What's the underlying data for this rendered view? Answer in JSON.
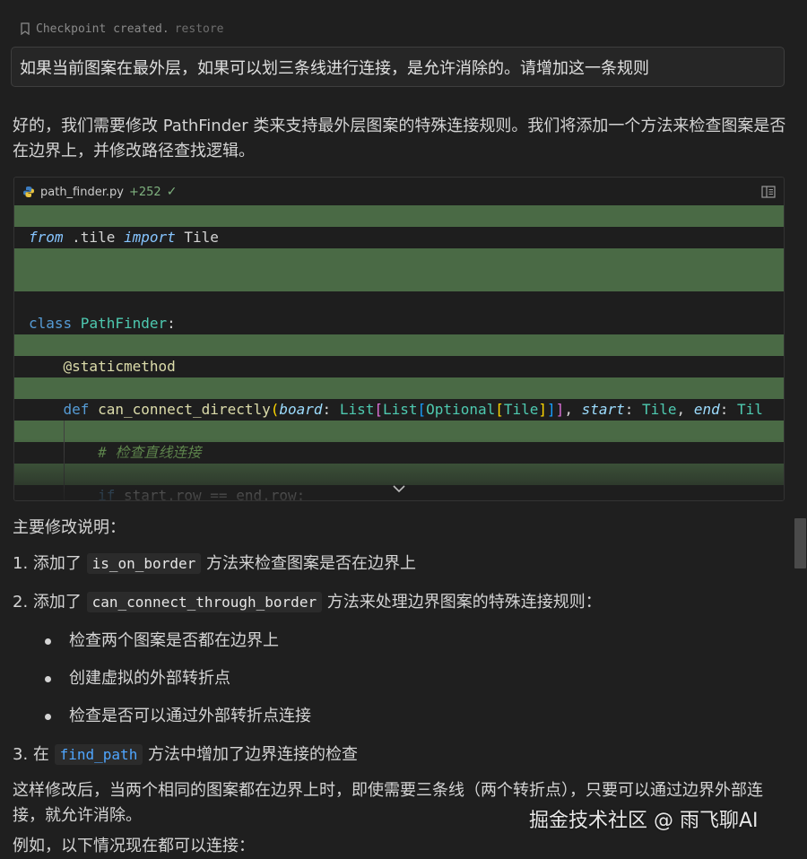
{
  "checkpoint": {
    "text": "Checkpoint created.",
    "restore": "restore"
  },
  "user_message": "如果当前图案在最外层，如果可以划三条线进行连接，是允许消除的。请增加这一条规则",
  "intro": "好的，我们需要修改 PathFinder 类来支持最外层图案的特殊连接规则。我们将添加一个方法来检查图案是否在边界上，并修改路径查找逻辑。",
  "code_card": {
    "file_name": "path_finder.py",
    "added_lines": "+252",
    "code": {
      "from": "from",
      "module": " .tile ",
      "import": "import",
      "import_name": " Tile",
      "class_kw": "class",
      "class_name": " PathFinder",
      "colon": ":",
      "decorator": "@staticmethod",
      "def": "def",
      "fn_name": " can_connect_directly",
      "p_board": "board",
      "t_list": "List",
      "t_optional": "Optional",
      "t_tile": "Tile",
      "p_start": "start",
      "p_end": "end",
      "tail_type": "Til",
      "comment": "# 检查直线连接",
      "if_kw": "if",
      "if_rest": " start.row == end.row:"
    }
  },
  "summary_heading": "主要修改说明：",
  "items": [
    {
      "prefix": "1. 添加了 ",
      "code": "is_on_border",
      "suffix": " 方法来检查图案是否在边界上"
    },
    {
      "prefix": "2. 添加了 ",
      "code": "can_connect_through_border",
      "suffix": " 方法来处理边界图案的特殊连接规则："
    },
    {
      "prefix": "3. 在 ",
      "code": "find_path",
      "suffix": " 方法中增加了边界连接的检查"
    }
  ],
  "bullets": [
    "检查两个图案是否都在边界上",
    "创建虚拟的外部转折点",
    "检查是否可以通过外部转折点连接"
  ],
  "explanation": "这样修改后，当两个相同的图案都在边界上时，即使需要三条线（两个转折点），只要可以通过边界外部连接，就允许消除。",
  "example_lead": "例如，以下情况现在都可以连接：",
  "watermark": "掘金技术社区 @ 雨飞聊AI"
}
